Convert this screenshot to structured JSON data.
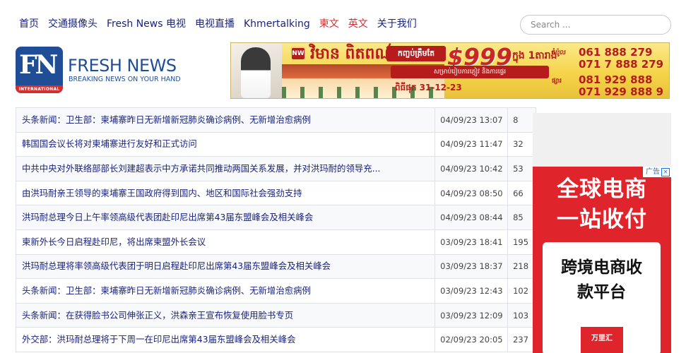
{
  "nav": {
    "items": [
      {
        "label": "首页",
        "highlight": false
      },
      {
        "label": "交通摄像头",
        "highlight": false
      },
      {
        "label": "Fresh News 电视",
        "highlight": false
      },
      {
        "label": "电视直播",
        "highlight": false
      },
      {
        "label": "Khmertalking",
        "highlight": false
      },
      {
        "label": "柬文",
        "highlight": true
      },
      {
        "label": "英文",
        "highlight": true
      },
      {
        "label": "关于我们",
        "highlight": false
      }
    ]
  },
  "search": {
    "placeholder": "Search ..."
  },
  "logo": {
    "mark": "FN",
    "badge": "INTERNATIONAL",
    "title": "FRESH NEWS",
    "tagline": "BREAKING NEWS ON YOUR HAND"
  },
  "banner_ad": {
    "badge": "NW",
    "venue_name": "វិមាន ពិតពណ៌",
    "promo_label": "កញ្ចប់ត្រឹមតែ",
    "price": "$999",
    "price_suffix": "ក្នុង 1តារាង",
    "subtitle": "សម្រាប់រៀបការភ្ញៀវ និងការផ្ទេរ",
    "validity": "ពិធីផុត 31-12-23",
    "phone_label_1": "កំប៉ូល",
    "phone_label_2": "ផ្សារ",
    "phones": [
      "061 888 279",
      "071 7 888 279",
      "081 929 888",
      "071 929 888 9"
    ]
  },
  "news": [
    {
      "title": "头条新闻：卫生部：柬埔寨昨日无新增新冠肺炎确诊病例、无新增治愈病例",
      "date": "04/09/23 13:07",
      "views": "8"
    },
    {
      "title": "韩国国会议长将对柬埔寨进行友好和正式访问",
      "date": "04/09/23 11:47",
      "views": "32"
    },
    {
      "title": "中共中央对外联络部部长刘建超表示中方承诺共同推动两国关系发展，并对洪玛耐的领导充...",
      "date": "04/09/23 10:42",
      "views": "53"
    },
    {
      "title": "由洪玛耐亲王领导的柬埔寨王国政府得到国内、地区和国际社会强劲支持",
      "date": "04/09/23 08:50",
      "views": "66"
    },
    {
      "title": "洪玛耐总理今日上午率领高级代表团赴印尼出席第43届东盟峰会及相关峰会",
      "date": "04/09/23 08:44",
      "views": "85"
    },
    {
      "title": "柬新外长今日启程赴印尼，将出席柬盟外长会议",
      "date": "03/09/23 18:41",
      "views": "195"
    },
    {
      "title": "洪玛耐总理将率领高级代表团于明日启程赴印尼出席第43届东盟峰会及相关峰会",
      "date": "03/09/23 18:37",
      "views": "218"
    },
    {
      "title": "头条新闻：卫生部：柬埔寨昨日无新增新冠肺炎确诊病例、无新增治愈病例",
      "date": "03/09/23 12:43",
      "views": "102"
    },
    {
      "title": "头条新闻：在获得脸书公司伸张正义，洪森亲王宣布恢复使用脸书专页",
      "date": "03/09/23 12:09",
      "views": "103"
    },
    {
      "title": "外交部：洪玛耐总理将于下周一在印尼出席第43届东盟峰会及相关峰会",
      "date": "02/09/23 20:05",
      "views": "237"
    }
  ],
  "side_ad": {
    "ad_label": "广告",
    "close": "×",
    "headline_1": "全球电商",
    "headline_2": "一站收付",
    "card_line_1": "跨境电商收",
    "card_line_2": "款平台",
    "brand": "万里汇"
  }
}
